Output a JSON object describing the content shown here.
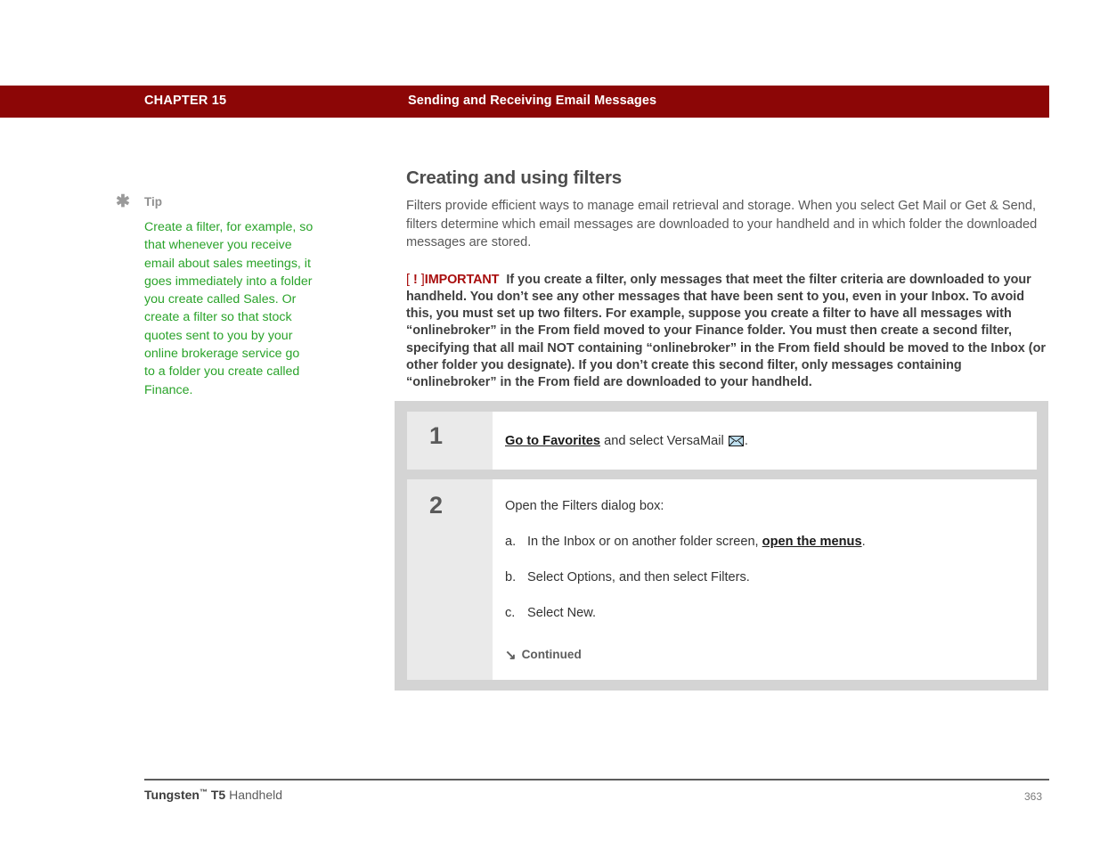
{
  "header": {
    "chapter": "CHAPTER 15",
    "title": "Sending and Receiving Email Messages",
    "bar_color": "#8c0606"
  },
  "sidebar": {
    "icon": "asterisk-icon",
    "label": "Tip",
    "text": "Create a filter, for example, so that whenever you receive email about sales meetings, it goes immediately into a folder you create called Sales. Or create a filter so that stock quotes sent to you by your online brokerage service go to a folder you create called Finance.",
    "text_color": "#2aa32a"
  },
  "main": {
    "section_title": "Creating and using filters",
    "intro": "Filters provide efficient ways to manage email retrieval and storage. When you select Get Mail or Get & Send, filters determine which email messages are downloaded to your handheld and in which folder the downloaded messages are stored.",
    "important": {
      "bracket_open": "[",
      "bang": "!",
      "bracket_close": "]",
      "label": "IMPORTANT",
      "label_color": "#a80d0d",
      "body": "If you create a filter, only messages that meet the filter criteria are downloaded to your handheld. You don’t see any other messages that have been sent to you, even in your Inbox. To avoid this, you must set up two filters. For example, suppose you create a filter to have all messages with “onlinebroker” in the From field moved to your Finance folder. You must then create a second filter, specifying that all mail NOT containing “onlinebroker” in the From field should be moved to the Inbox (or other folder you designate). If you don’t create this second filter, only messages containing “onlinebroker” in the From field are downloaded to your handheld."
    }
  },
  "steps": [
    {
      "number": "1",
      "lead_link": "Go to Favorites",
      "lead_rest": " and select VersaMail ",
      "lead_icon": "envelope-icon",
      "lead_end": "."
    },
    {
      "number": "2",
      "line": "Open the Filters dialog box:",
      "substeps": [
        {
          "marker": "a.",
          "text_before": "In the Inbox or on another folder screen, ",
          "link": "open the menus",
          "text_after": "."
        },
        {
          "marker": "b.",
          "text_before": "Select Options, and then select Filters.",
          "link": "",
          "text_after": ""
        },
        {
          "marker": "c.",
          "text_before": "Select New.",
          "link": "",
          "text_after": ""
        }
      ],
      "continued_arrow": "↘",
      "continued_label": "Continued"
    }
  ],
  "footer": {
    "product": "Tungsten",
    "tm": "™",
    "model": " T5",
    "suffix": " Handheld",
    "page_number": "363"
  }
}
